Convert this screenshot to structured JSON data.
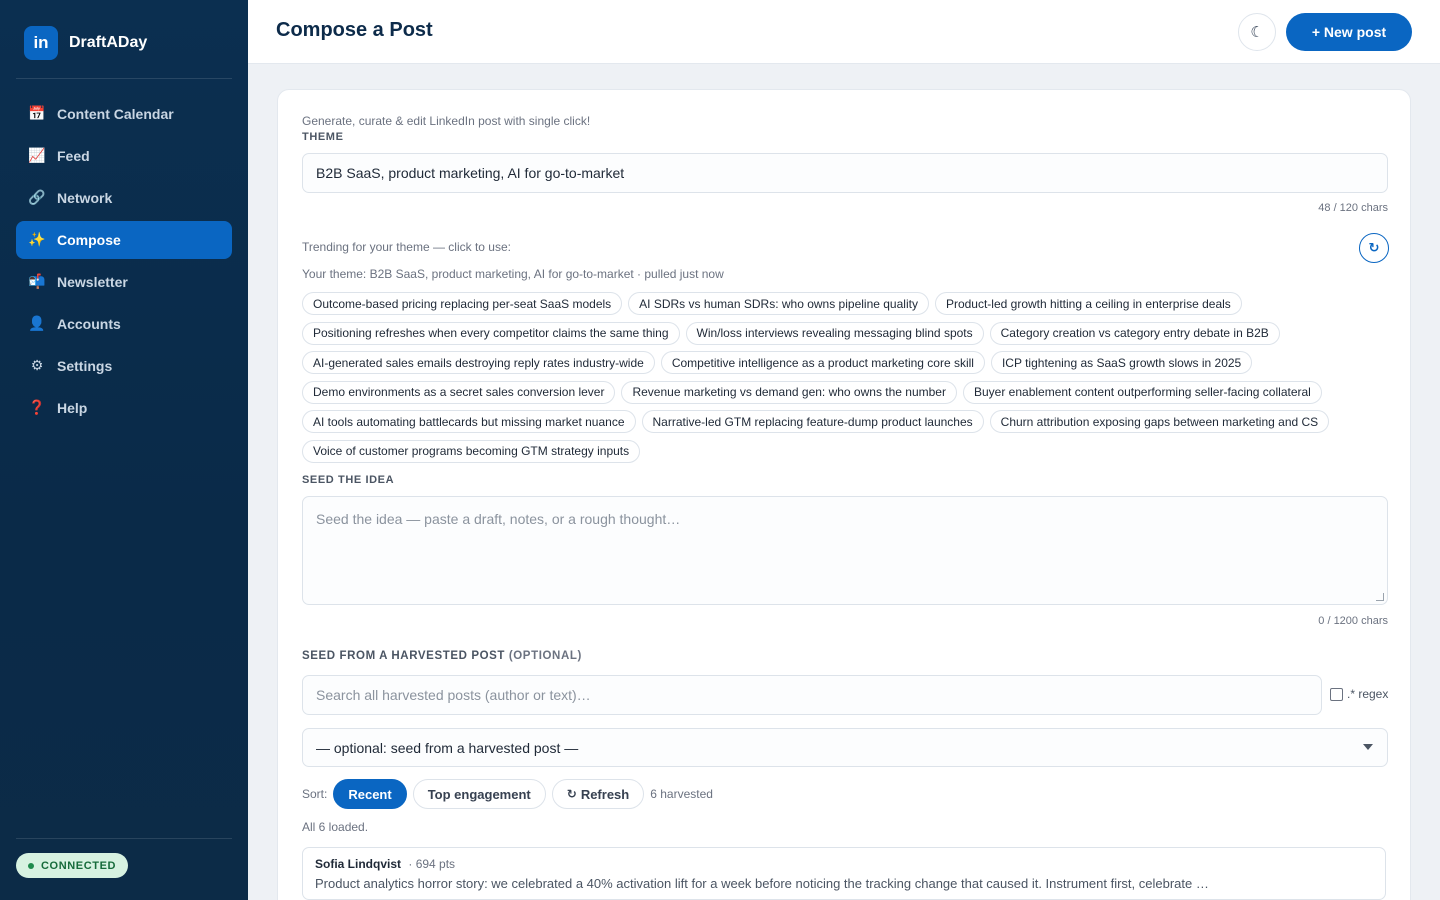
{
  "brand": {
    "logo_text": "in",
    "name": "DraftADay"
  },
  "sidebar": {
    "items": [
      {
        "icon": "calendar-icon",
        "glyph": "📅",
        "label": "Content Calendar",
        "active": false
      },
      {
        "icon": "chart-icon",
        "glyph": "📈",
        "label": "Feed",
        "active": false
      },
      {
        "icon": "link-icon",
        "glyph": "🔗",
        "label": "Network",
        "active": false
      },
      {
        "icon": "sparkles-icon",
        "glyph": "✨",
        "label": "Compose",
        "active": true
      },
      {
        "icon": "mailbox-icon",
        "glyph": "📬",
        "label": "Newsletter",
        "active": false
      },
      {
        "icon": "user-icon",
        "glyph": "👤",
        "label": "Accounts",
        "active": false
      },
      {
        "icon": "gear-icon",
        "glyph": "⚙",
        "label": "Settings",
        "active": false
      },
      {
        "icon": "help-icon",
        "glyph": "❓",
        "label": "Help",
        "active": false
      }
    ],
    "status": "CONNECTED"
  },
  "header": {
    "title": "Compose a Post",
    "theme_toggle_glyph": "☾",
    "new_post_label": "+ New post"
  },
  "compose": {
    "subtitle": "Generate, curate & edit LinkedIn post with single click!",
    "theme_label": "THEME",
    "theme_value": "B2B SaaS, product marketing, AI for go-to-market",
    "theme_counter": "48 / 120 chars",
    "trending_label": "Trending for your theme — click to use:",
    "trending_refresh_glyph": "↻",
    "trending_meta": "Your theme: B2B SaaS, product marketing, AI for go-to-market · pulled just now",
    "trending_topics": [
      "Outcome-based pricing replacing per-seat SaaS models",
      "AI SDRs vs human SDRs: who owns pipeline quality",
      "Product-led growth hitting a ceiling in enterprise deals",
      "Positioning refreshes when every competitor claims the same thing",
      "Win/loss interviews revealing messaging blind spots",
      "Category creation vs category entry debate in B2B",
      "AI-generated sales emails destroying reply rates industry-wide",
      "Competitive intelligence as a product marketing core skill",
      "ICP tightening as SaaS growth slows in 2025",
      "Demo environments as a secret sales conversion lever",
      "Revenue marketing vs demand gen: who owns the number",
      "Buyer enablement content outperforming seller-facing collateral",
      "AI tools automating battlecards but missing market nuance",
      "Narrative-led GTM replacing feature-dump product launches",
      "Churn attribution exposing gaps between marketing and CS",
      "Voice of customer programs becoming GTM strategy inputs"
    ],
    "seed_label": "SEED THE IDEA",
    "seed_placeholder": "Seed the idea — paste a draft, notes, or a rough thought…",
    "seed_counter": "0 / 1200 chars",
    "harvest_label": "SEED FROM A HARVESTED POST",
    "harvest_label_optional": "(OPTIONAL)",
    "search_placeholder": "Search all harvested posts (author or text)…",
    "regex_label": ".* regex",
    "select_value": "— optional: seed from a harvested post —",
    "sort_label": "Sort:",
    "sort_recent": "Recent",
    "sort_top": "Top engagement",
    "refresh_glyph": "↻",
    "refresh_label": "Refresh",
    "harvested_count": "6 harvested",
    "loaded_text": "All 6 loaded.",
    "posts": [
      {
        "author": "Sofia Lindqvist",
        "points": "· 694 pts",
        "text": "Product analytics horror story: we celebrated a 40% activation lift for a week before noticing the tracking change that caused it. Instrument first, celebrate …"
      }
    ]
  },
  "colors": {
    "accent": "#0a66c2",
    "sidebar_bg": "#0b2f50",
    "connected_bg": "#d7f2e1"
  }
}
